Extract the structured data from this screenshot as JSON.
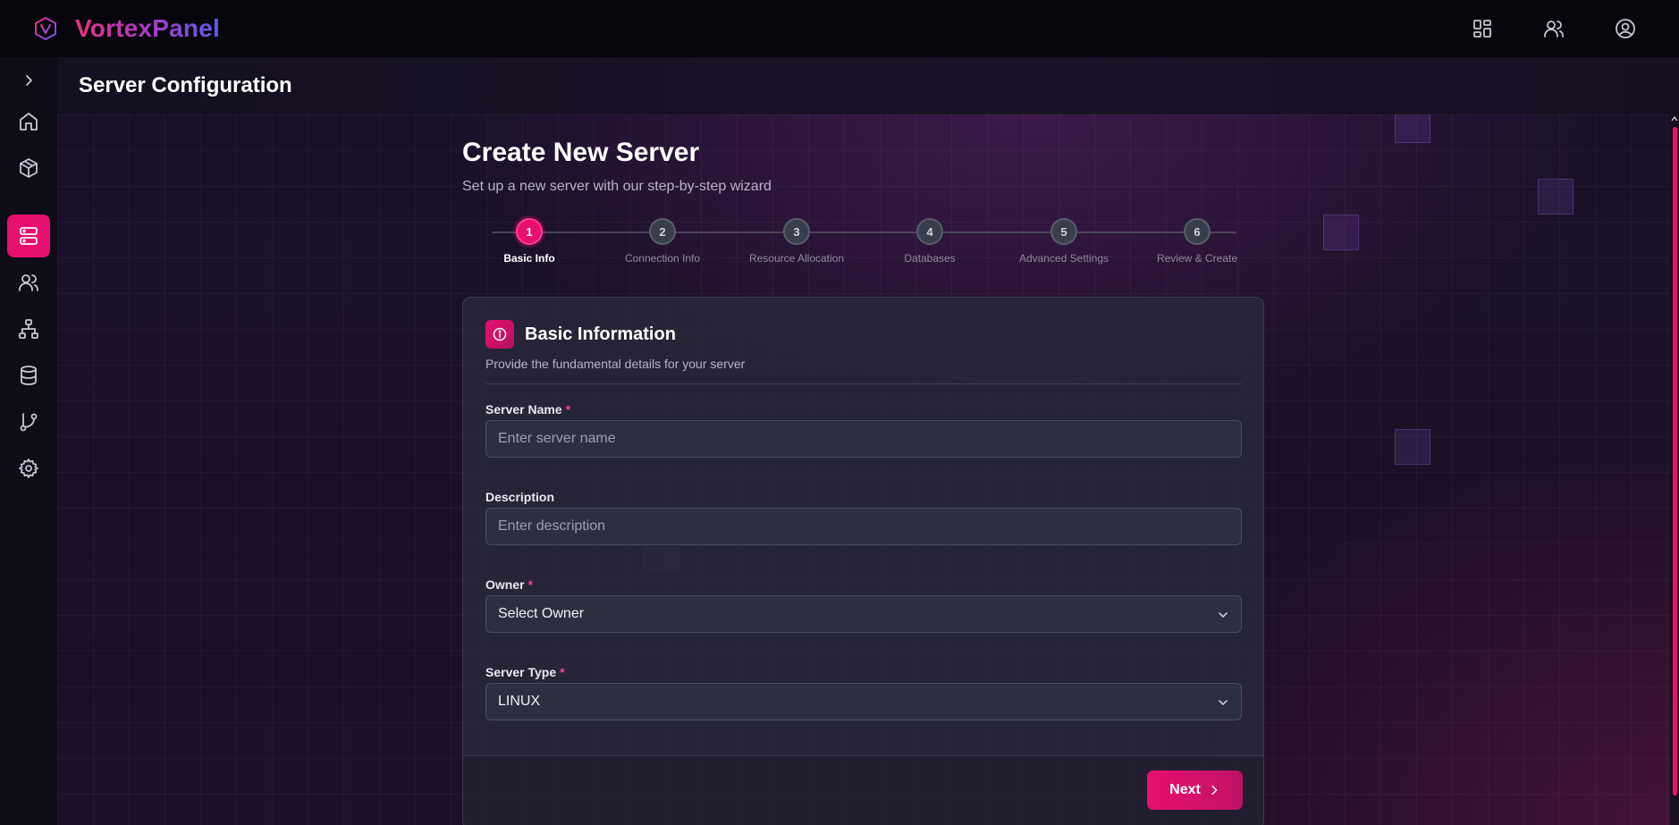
{
  "app": {
    "brand": "VortexPanel"
  },
  "header": {
    "title": "Server Configuration"
  },
  "topbar": {
    "actions": [
      {
        "icon": "dashboard-grid-icon"
      },
      {
        "icon": "users-icon"
      },
      {
        "icon": "user-circle-icon"
      }
    ]
  },
  "sidebar": {
    "items": [
      {
        "icon": "home-icon"
      },
      {
        "icon": "box-icon"
      },
      {
        "icon": "server-icon",
        "active": true
      },
      {
        "icon": "users-icon"
      },
      {
        "icon": "network-icon"
      },
      {
        "icon": "database-icon"
      },
      {
        "icon": "git-branch-icon"
      },
      {
        "icon": "gear-icon"
      }
    ]
  },
  "wizard": {
    "title": "Create New Server",
    "subtitle": "Set up a new server with our step-by-step wizard",
    "steps": [
      {
        "number": "1",
        "label": "Basic Info",
        "active": true
      },
      {
        "number": "2",
        "label": "Connection Info"
      },
      {
        "number": "3",
        "label": "Resource Allocation"
      },
      {
        "number": "4",
        "label": "Databases"
      },
      {
        "number": "5",
        "label": "Advanced Settings"
      },
      {
        "number": "6",
        "label": "Review & Create"
      }
    ]
  },
  "form": {
    "title": "Basic Information",
    "description": "Provide the fundamental details for your server",
    "server_name": {
      "label": "Server Name",
      "required_mark": "*",
      "value": "",
      "placeholder": "Enter server name"
    },
    "description_field": {
      "label": "Description",
      "value": "",
      "placeholder": "Enter description"
    },
    "owner": {
      "label": "Owner",
      "required_mark": "*",
      "selected": "Select Owner"
    },
    "server_type": {
      "label": "Server Type",
      "required_mark": "*",
      "selected": "LINUX"
    },
    "next_label": "Next"
  },
  "colors": {
    "accent": "#e8106e",
    "background": "#1a1128",
    "card": "#282838"
  }
}
